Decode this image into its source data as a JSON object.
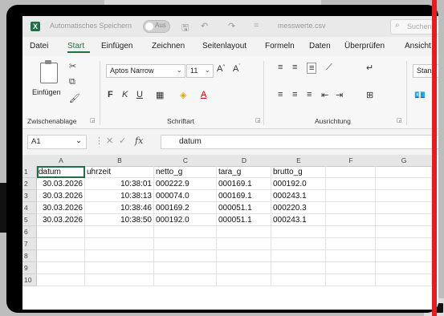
{
  "title_bar": {
    "autosave_label": "Automatisches Speichern",
    "autosave_state": "Aus",
    "document_title": "messwerte.csv",
    "search_placeholder": "Suchen"
  },
  "menu": {
    "items": [
      "Datei",
      "Start",
      "Einfügen",
      "Zeichnen",
      "Seitenlayout",
      "Formeln",
      "Daten",
      "Überprüfen",
      "Ansicht"
    ],
    "active": "Start"
  },
  "ribbon": {
    "clipboard": {
      "paste_label": "Einfügen",
      "group_label": "Zwischenablage"
    },
    "font": {
      "font_name": "Aptos Narrow",
      "font_size": "11",
      "bold": "F",
      "italic": "K",
      "underline": "U",
      "group_label": "Schriftart"
    },
    "alignment": {
      "group_label": "Ausrichtung"
    },
    "number": {
      "format": "Stand"
    }
  },
  "formula_bar": {
    "name_box": "A1",
    "content": "datum"
  },
  "sheet": {
    "columns": [
      "A",
      "B",
      "C",
      "D",
      "E",
      "F",
      "G"
    ],
    "row_numbers": [
      "1",
      "2",
      "3",
      "4",
      "5",
      "6",
      "7",
      "8",
      "9",
      "10"
    ],
    "header_row": [
      "datum",
      "uhrzeit",
      "netto_g",
      "tara_g",
      "brutto_g"
    ],
    "rows": [
      [
        "30.03.2026",
        "10:38:01",
        "000222.9",
        "000169.1",
        "000192.0"
      ],
      [
        "30.03.2026",
        "10:38:13",
        "000074.0",
        "000169.1",
        "000243.1"
      ],
      [
        "30.03.2026",
        "10:38:46",
        "000169.2",
        "000051.1",
        "000220.3"
      ],
      [
        "30.03.2026",
        "10:38:50",
        "000192.0",
        "000051.1",
        "000243.1"
      ]
    ]
  },
  "colors": {
    "excel_green": "#1e7145",
    "overlay_red": "#e81c1c"
  }
}
